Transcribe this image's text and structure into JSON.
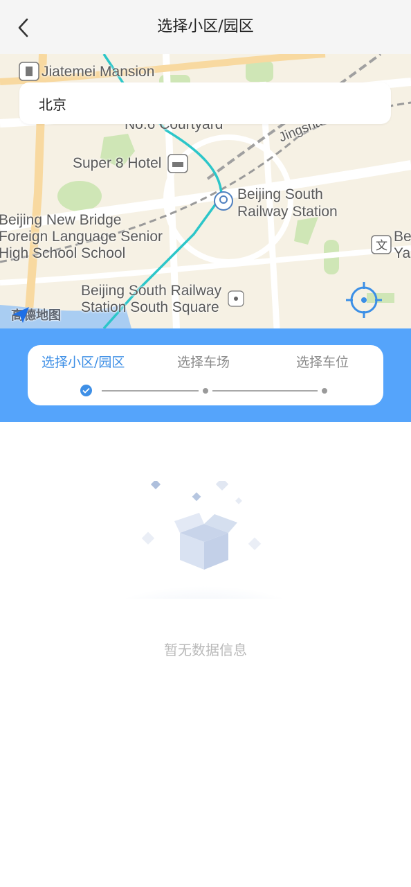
{
  "header": {
    "title": "选择小区/园区",
    "back_icon": "chevron-left-icon"
  },
  "map": {
    "labels": {
      "jiatemei": "Jiatemei Mansion",
      "courtyard": "No.6 Courtyard",
      "super8": "Super 8 Hotel",
      "station": "Beijing South\nRailway Station",
      "school": "Beijing New Bridge\nForeign Language Senior\nHigh School School",
      "square": "Beijing South Railway\nStation South Square",
      "jingsh": "Jingsha",
      "right_edge": "Be\nYa"
    },
    "provider_logo": "高德地图",
    "search": {
      "value": "北京"
    }
  },
  "steps": {
    "items": [
      {
        "label": "选择小区/园区",
        "active": true
      },
      {
        "label": "选择车场",
        "active": false
      },
      {
        "label": "选择车位",
        "active": false
      }
    ]
  },
  "empty": {
    "text": "暂无数据信息"
  },
  "colors": {
    "accent": "#55a4fb",
    "active_step": "#3e8fe6",
    "header_bg": "#f5f5f5",
    "map_bg": "#f6f1e4",
    "subway_line": "#2cc6c9"
  }
}
